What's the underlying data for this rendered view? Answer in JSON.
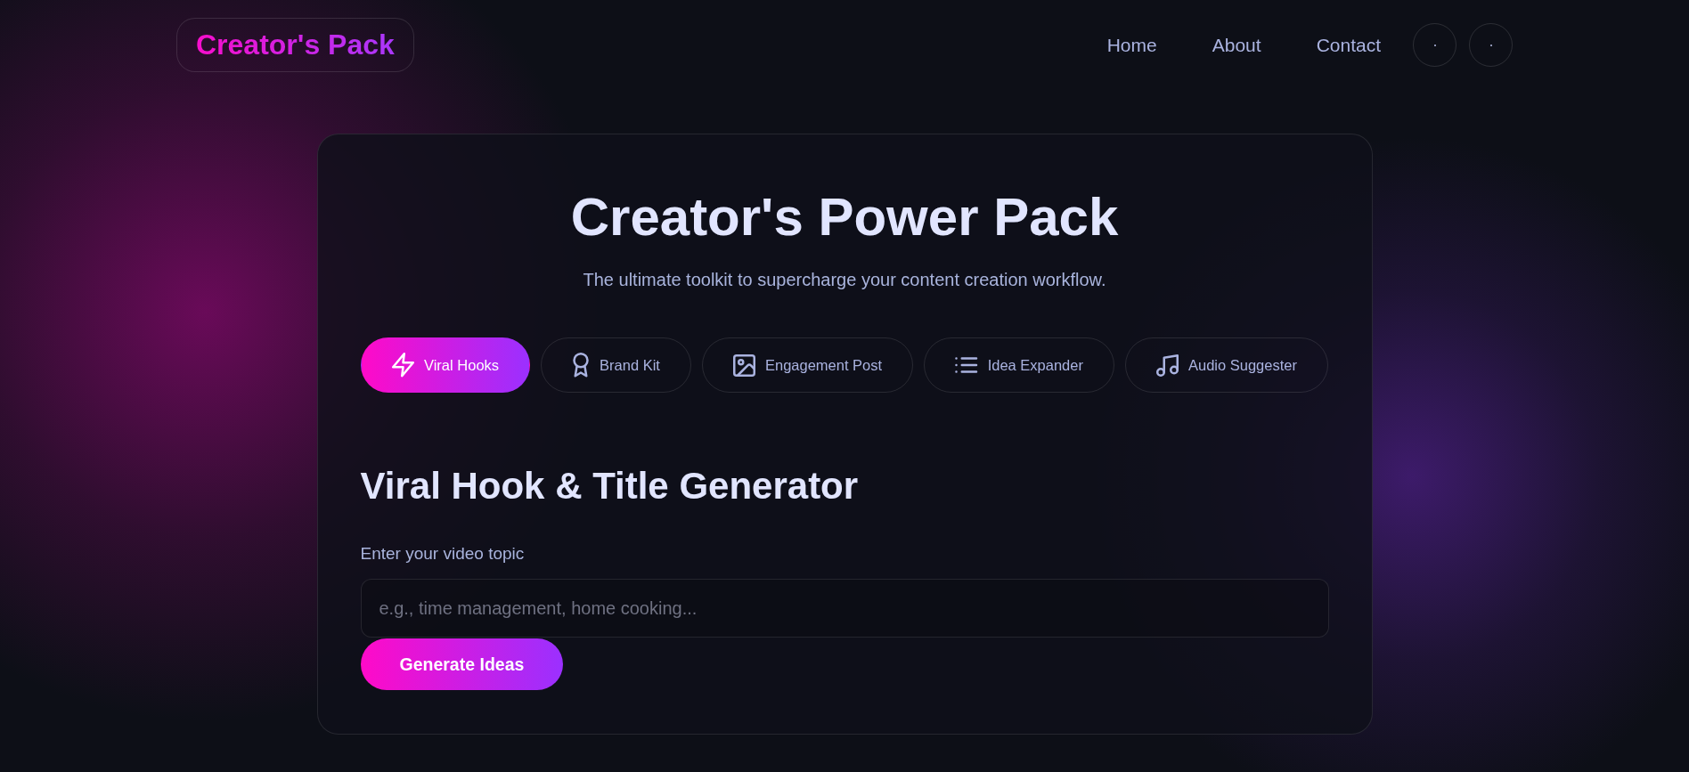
{
  "header": {
    "logo": "Creator's Pack",
    "nav": [
      "Home",
      "About",
      "Contact"
    ],
    "icon_buttons": [
      {
        "kind": "dot"
      },
      {
        "kind": "dot"
      }
    ]
  },
  "hero": {
    "title": "Creator's Power Pack",
    "subtitle": "The ultimate toolkit to supercharge your content creation workflow."
  },
  "tabs": [
    {
      "label": "Viral Hooks",
      "selected": true
    },
    {
      "label": "Brand Kit",
      "selected": false
    },
    {
      "label": "Engagement Post",
      "selected": false
    },
    {
      "label": "Idea Expander",
      "selected": false
    },
    {
      "label": "Audio Suggester",
      "selected": false
    }
  ],
  "panel": {
    "heading": "Viral Hook & Title Generator",
    "field": {
      "label": "Enter your video topic",
      "placeholder": "e.g., time management, home cooking..."
    },
    "button": "Generate Ideas"
  }
}
